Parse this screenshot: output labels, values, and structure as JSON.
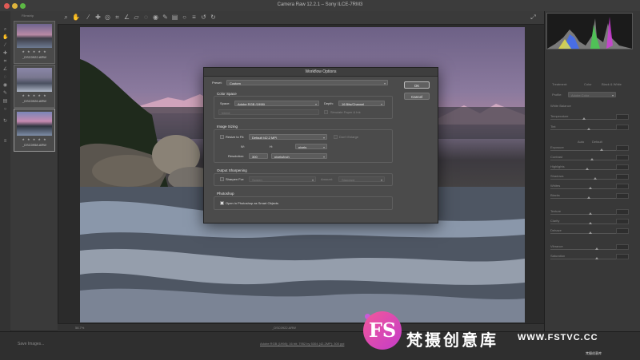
{
  "app": {
    "title": "Camera Raw 12.2.1 – Sony ILCE-7RM3"
  },
  "filmstrip": {
    "header": "Filmstrip",
    "items": [
      {
        "name": "_DSC0922.ARW",
        "stars": "★ ★ ★ ★ ★"
      },
      {
        "name": "_DSC0926.ARW",
        "stars": "★ ★ ★ ★ ★"
      },
      {
        "name": "_DSC0958.ARW",
        "stars": "★ ★ ★ ★ ★"
      }
    ]
  },
  "bottombar": {
    "zoom": "58.7%",
    "filename": "_DSC0922.ARW"
  },
  "statusbar": {
    "left": "Save Images...",
    "info": "Adobe RGB (1998); 16 bit; 7952 by 5304 (42.2MP); 300 ppi"
  },
  "right_panel": {
    "tabs": [
      "Treatment:",
      "Color",
      "Black & White"
    ],
    "profile_label": "Profile:",
    "profile_value": "Adobe Color",
    "sliders": [
      "White Balance",
      "Temperature",
      "Tint",
      "Auto",
      "Default",
      "Exposure",
      "Contrast",
      "Highlights",
      "Shadows",
      "Whites",
      "Blacks",
      "Texture",
      "Clarity",
      "Dehaze",
      "Vibrance",
      "Saturation"
    ]
  },
  "dialog": {
    "title": "Workflow Options",
    "preset_label": "Preset:",
    "preset_value": "Custom",
    "ok": "OK",
    "cancel": "Cancel",
    "color_space": {
      "heading": "Color Space",
      "space_label": "Space:",
      "space_value": "Adobe RGB (1998)",
      "depth_label": "Depth:",
      "depth_value": "16 Bits/Channel",
      "intent_label": "Intent:",
      "simulate_label": "Simulate Paper & Ink"
    },
    "image_sizing": {
      "heading": "Image Sizing",
      "resize_label": "Resize to Fit:",
      "resize_value": "Default (42.2 MP)",
      "enlarge_label": "Don't Enlarge",
      "w_label": "W:",
      "h_label": "H:",
      "units_value": "pixels",
      "resolution_label": "Resolution:",
      "resolution_value": "300",
      "resolution_units": "pixels/inch"
    },
    "output_sharpening": {
      "heading": "Output Sharpening",
      "sharpen_label": "Sharpen For:",
      "sharpen_value": "Screen",
      "amount_label": "Amount:",
      "amount_value": "Standard"
    },
    "photoshop": {
      "heading": "Photoshop",
      "smart_objects_label": "Open in Photoshop as Smart Objects"
    }
  },
  "watermark": {
    "logo": "FS",
    "text": "梵摄创意库",
    "url": "WWW.FSTVC.CC",
    "small": "梵摄创意库"
  },
  "colors": {
    "dialog_bg": "#4b4b4b",
    "watermark_pink": "#f2589a"
  }
}
